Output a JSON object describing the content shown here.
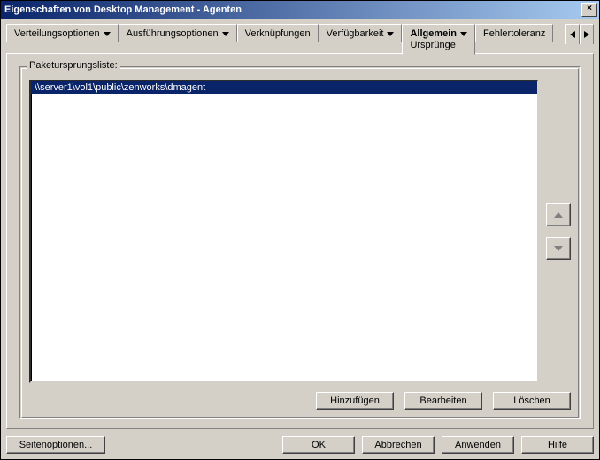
{
  "window": {
    "title": "Eigenschaften von Desktop Management - Agenten",
    "close_glyph": "×"
  },
  "tabs": {
    "items": [
      {
        "label": "Verteilungsoptionen",
        "hasDropdown": true
      },
      {
        "label": "Ausführungsoptionen",
        "hasDropdown": true
      },
      {
        "label": "Verknüpfungen",
        "hasDropdown": false
      },
      {
        "label": "Verfügbarkeit",
        "hasDropdown": true
      },
      {
        "label": "Allgemein",
        "hasDropdown": true,
        "active": true,
        "subpage": "Ursprünge"
      },
      {
        "label": "Fehlertoleranz",
        "hasDropdown": false
      }
    ]
  },
  "group": {
    "legend": "Paketursprungsliste:",
    "list_items": [
      {
        "text": "\\\\server1\\vol1\\public\\zenworks\\dmagent",
        "selected": true
      }
    ],
    "buttons": {
      "add": "Hinzufügen",
      "edit": "Bearbeiten",
      "delete": "Löschen"
    }
  },
  "dialog_buttons": {
    "page_options": "Seitenoptionen...",
    "ok": "OK",
    "cancel": "Abbrechen",
    "apply": "Anwenden",
    "help": "Hilfe"
  }
}
